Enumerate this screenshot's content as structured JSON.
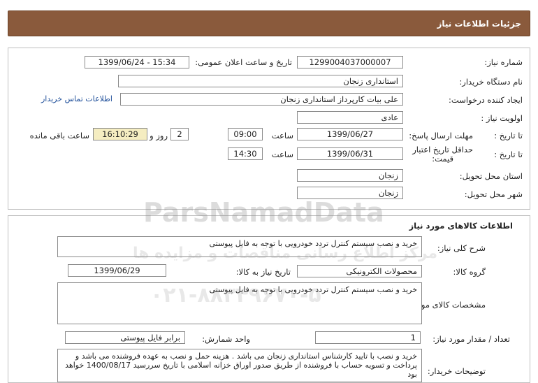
{
  "header": {
    "title": "جزئیات اطلاعات نیاز"
  },
  "need_info": {
    "need_number_label": "شماره نیاز:",
    "need_number": "1299004037000007",
    "announce_label": "تاریخ و ساعت اعلان عمومی:",
    "announce_value": "1399/06/24 - 15:34",
    "buyer_org_label": "نام دستگاه خریدار:",
    "buyer_org": "استانداری زنجان",
    "requester_label": "ایجاد کننده درخواست:",
    "requester": "علی بیات کارپرداز  استانداری زنجان",
    "contact_link": "اطلاعات تماس خریدار",
    "priority_label": "اولویت نیاز :",
    "priority": "عادی",
    "deadline_label": "مهلت ارسال پاسخ:",
    "to_date_label": "تا تاریخ :",
    "deadline_date": "1399/06/27",
    "time_label": "ساعت",
    "deadline_time": "09:00",
    "days_value": "2",
    "days_label": "روز و",
    "remaining_time": "16:10:29",
    "remaining_label": "ساعت باقی مانده",
    "validity_label_1": "حداقل تاریخ اعتبار",
    "validity_label_2": "قیمت:",
    "validity_date": "1399/06/31",
    "validity_time": "14:30",
    "delivery_province_label": "استان محل تحویل:",
    "delivery_province": "زنجان",
    "delivery_city_label": "شهر محل تحویل:",
    "delivery_city": "زنجان"
  },
  "goods": {
    "section_title": "اطلاعات کالاهای مورد نیاز",
    "summary_label": "شرح کلی نیاز:",
    "summary": "خرید و نصب سیستم کنترل تردد خودرویی  با توجه به فایل پیوستی",
    "group_label": "گروه کالا:",
    "group": "محصولات الکترونیکی",
    "need_date_label": "تاریخ نیاز به کالا:",
    "need_date": "1399/06/29",
    "specs_label": "مشخصات کالای مورد نیاز:",
    "specs": "خرید و نصب سیستم کنترل تردد خودرویی  با توجه به فایل پیوستی",
    "qty_label": "تعداد / مقدار مورد نیاز:",
    "qty": "1",
    "unit_label": "واحد شمارش:",
    "unit": "برابر فایل پیوستی",
    "notes_label": "توضیحات خریدار:",
    "notes": "خرید و نصب با تایید کارشناس استانداری زنجان می باشد . هزینه حمل و نصب به عهده فروشنده می باشد و پرداخت و تسویه حساب با فروشنده از طریق صدور اوراق خزانه اسلامی با تاریخ سررسید 1400/08/17 خواهد بود"
  },
  "watermark": {
    "brand": "ParsNamadData",
    "line1": "مرکز اطلاع رسانی مناقصات و مزایده ها",
    "phone": "۰۲۱-۸۸۳۴۹۶۷۰-۵"
  }
}
